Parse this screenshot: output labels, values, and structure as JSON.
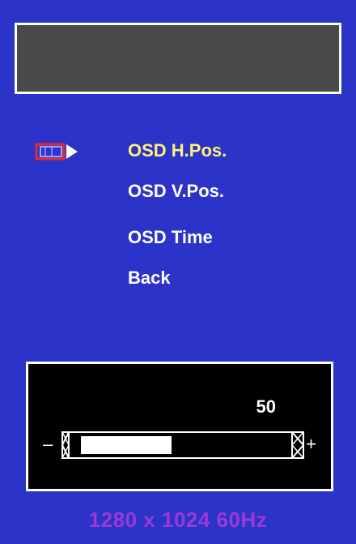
{
  "menu": {
    "items": [
      {
        "label": "OSD H.Pos.",
        "selected": true
      },
      {
        "label": "OSD V.Pos.",
        "selected": false
      },
      {
        "label": "OSD Time",
        "selected": false
      },
      {
        "label": "Back",
        "selected": false
      }
    ]
  },
  "adjustment": {
    "value": "50",
    "minus_label": "–",
    "plus_label": "+",
    "fill_fraction": 0.5
  },
  "status": {
    "resolution": "1280 x 1024  60Hz"
  },
  "colors": {
    "background": "#2b33c8",
    "selected_text": "#fff176",
    "resolution_text": "#9b39d8"
  }
}
